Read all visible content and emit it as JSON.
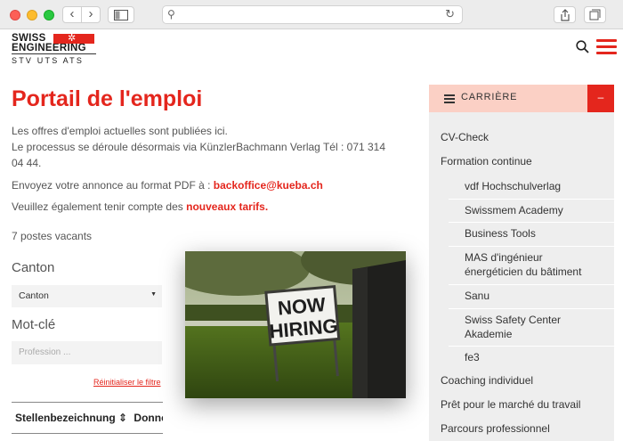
{
  "browser": {
    "back_icon": "chevron-left",
    "forward_icon": "chevron-right",
    "sidebar_icon": "sidebar",
    "search_icon": "magnifier",
    "reload_icon": "reload",
    "share_icon": "share",
    "tabs_icon": "tabs"
  },
  "logo": {
    "line1": "SWISS",
    "line2": "ENGINEERING",
    "line3": "STV  UTS  ATS"
  },
  "colors": {
    "accent": "#e4261d",
    "sidebar_head": "#fbd0c5",
    "sidebar_bg": "#eeeeee"
  },
  "main": {
    "title": "Portail de l'emploi",
    "intro_line1": "Les offres d'emploi actuelles sont publiées ici.",
    "intro_line2": "Le processus se déroule désormais via KünzlerBachmann Verlag Tél : 071 314 04 44.",
    "pdf_text": "Envoyez votre annonce au format PDF à :",
    "pdf_email": "backoffice@kueba.ch",
    "tarif_text": "Veuillez également tenir compte des",
    "tarif_link": "nouveaux tarifs.",
    "postes": "7 postes vacants",
    "canton_label": "Canton",
    "canton_value": "Canton",
    "motcle_label": "Mot-clé",
    "motcle_placeholder": "Profession ...",
    "reset_link": "Réinitialiser le filtre",
    "table_col1": "Stellenbezeichnung ⇕",
    "table_col2": "Données",
    "photo_sign_line1": "NOW",
    "photo_sign_line2": "HIRING"
  },
  "sidebar": {
    "header": "CARRIÈRE",
    "collapse": "–",
    "items": [
      "CV-Check",
      "Formation continue",
      "vdf Hochschulverlag",
      "Swissmem Academy",
      "Business Tools",
      "MAS d'ingénieur énergéticien du bâtiment",
      "Sanu",
      "Swiss Safety Center Akademie",
      "fe3",
      "Coaching individuel",
      "Prêt pour le marché du travail",
      "Parcours professionnel"
    ]
  }
}
